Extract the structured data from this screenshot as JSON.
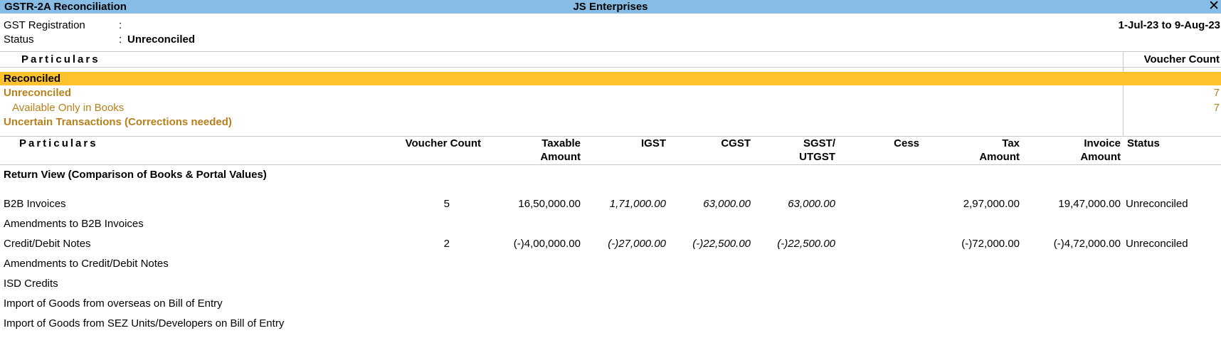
{
  "titlebar": {
    "left": "GSTR-2A Reconciliation",
    "center": "JS Enterprises",
    "close_glyph": "✕"
  },
  "header": {
    "gst_label": "GST Registration",
    "gst_colon": ":",
    "gst_value": "",
    "status_label": "Status",
    "status_colon": ":",
    "status_value": "Unreconciled",
    "period": "1-Jul-23 to 9-Aug-23"
  },
  "summary": {
    "col_particulars": "Particulars",
    "col_voucher_count": "Voucher Count",
    "rows": [
      {
        "label": "Reconciled",
        "count": ""
      },
      {
        "label": "Unreconciled",
        "count": "7"
      },
      {
        "label": "Available Only in Books",
        "count": "7"
      },
      {
        "label": "Uncertain Transactions (Corrections needed)",
        "count": ""
      }
    ]
  },
  "table": {
    "headers": {
      "particulars": "Particulars",
      "voucher_count": "Voucher Count",
      "taxable_1": "Taxable",
      "taxable_2": "Amount",
      "igst": "IGST",
      "cgst": "CGST",
      "sgst_1": "SGST/",
      "sgst_2": "UTGST",
      "cess": "Cess",
      "tax_1": "Tax",
      "tax_2": "Amount",
      "invoice_1": "Invoice",
      "invoice_2": "Amount",
      "status": "Status"
    },
    "section_title": "Return View (Comparison of Books & Portal Values)",
    "rows": [
      {
        "name": "B2B Invoices",
        "voucher_count": "5",
        "taxable": "16,50,000.00",
        "igst": "1,71,000.00",
        "cgst": "63,000.00",
        "sgst": "63,000.00",
        "cess": "",
        "tax_amount": "2,97,000.00",
        "invoice_amount": "19,47,000.00",
        "status": "Unreconciled"
      },
      {
        "name": "Amendments to B2B Invoices",
        "voucher_count": "",
        "taxable": "",
        "igst": "",
        "cgst": "",
        "sgst": "",
        "cess": "",
        "tax_amount": "",
        "invoice_amount": "",
        "status": ""
      },
      {
        "name": "Credit/Debit Notes",
        "voucher_count": "2",
        "taxable": "(-)4,00,000.00",
        "igst": "(-)27,000.00",
        "cgst": "(-)22,500.00",
        "sgst": "(-)22,500.00",
        "cess": "",
        "tax_amount": "(-)72,000.00",
        "invoice_amount": "(-)4,72,000.00",
        "status": "Unreconciled"
      },
      {
        "name": "Amendments to Credit/Debit Notes",
        "voucher_count": "",
        "taxable": "",
        "igst": "",
        "cgst": "",
        "sgst": "",
        "cess": "",
        "tax_amount": "",
        "invoice_amount": "",
        "status": ""
      },
      {
        "name": "ISD Credits",
        "voucher_count": "",
        "taxable": "",
        "igst": "",
        "cgst": "",
        "sgst": "",
        "cess": "",
        "tax_amount": "",
        "invoice_amount": "",
        "status": ""
      },
      {
        "name": "Import of Goods from overseas on Bill of Entry",
        "voucher_count": "",
        "taxable": "",
        "igst": "",
        "cgst": "",
        "sgst": "",
        "cess": "",
        "tax_amount": "",
        "invoice_amount": "",
        "status": ""
      },
      {
        "name": "Import of Goods from SEZ Units/Developers on Bill of Entry",
        "voucher_count": "",
        "taxable": "",
        "igst": "",
        "cgst": "",
        "sgst": "",
        "cess": "",
        "tax_amount": "",
        "invoice_amount": "",
        "status": ""
      }
    ]
  },
  "colors": {
    "titlebar": "#87bde4",
    "selected_row": "#fdc22d",
    "orange_text": "#b8801c"
  }
}
